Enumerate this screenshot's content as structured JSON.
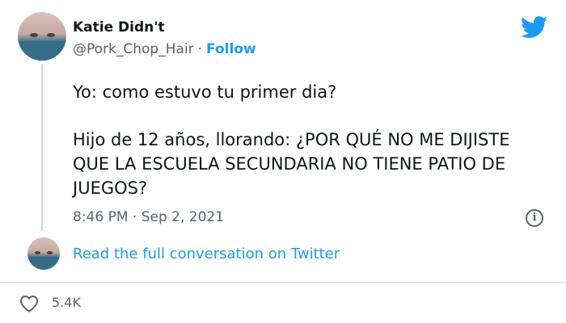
{
  "author": {
    "display_name": "Katie Didn't",
    "handle": "@Pork_Chop_Hair",
    "follow_label": "Follow"
  },
  "tweet": {
    "line1": "Yo: como estuvo tu primer dia?",
    "line2": "Hijo de 12 años, llorando: ¿POR QUÉ NO ME DIJISTE QUE LA ESCUELA SECUNDARIA NO TIENE PATIO DE JUEGOS?",
    "timestamp": "8:46 PM · Sep 2, 2021"
  },
  "thread": {
    "read_more_label": "Read the full conversation on Twitter"
  },
  "engagement": {
    "like_count": "5.4K"
  },
  "icons": {
    "brand": "twitter-bird-icon",
    "info": "info-icon",
    "like": "heart-icon"
  },
  "colors": {
    "accent": "#1d9bf0",
    "secondary_text": "#536471",
    "divider": "#cfd9de"
  }
}
